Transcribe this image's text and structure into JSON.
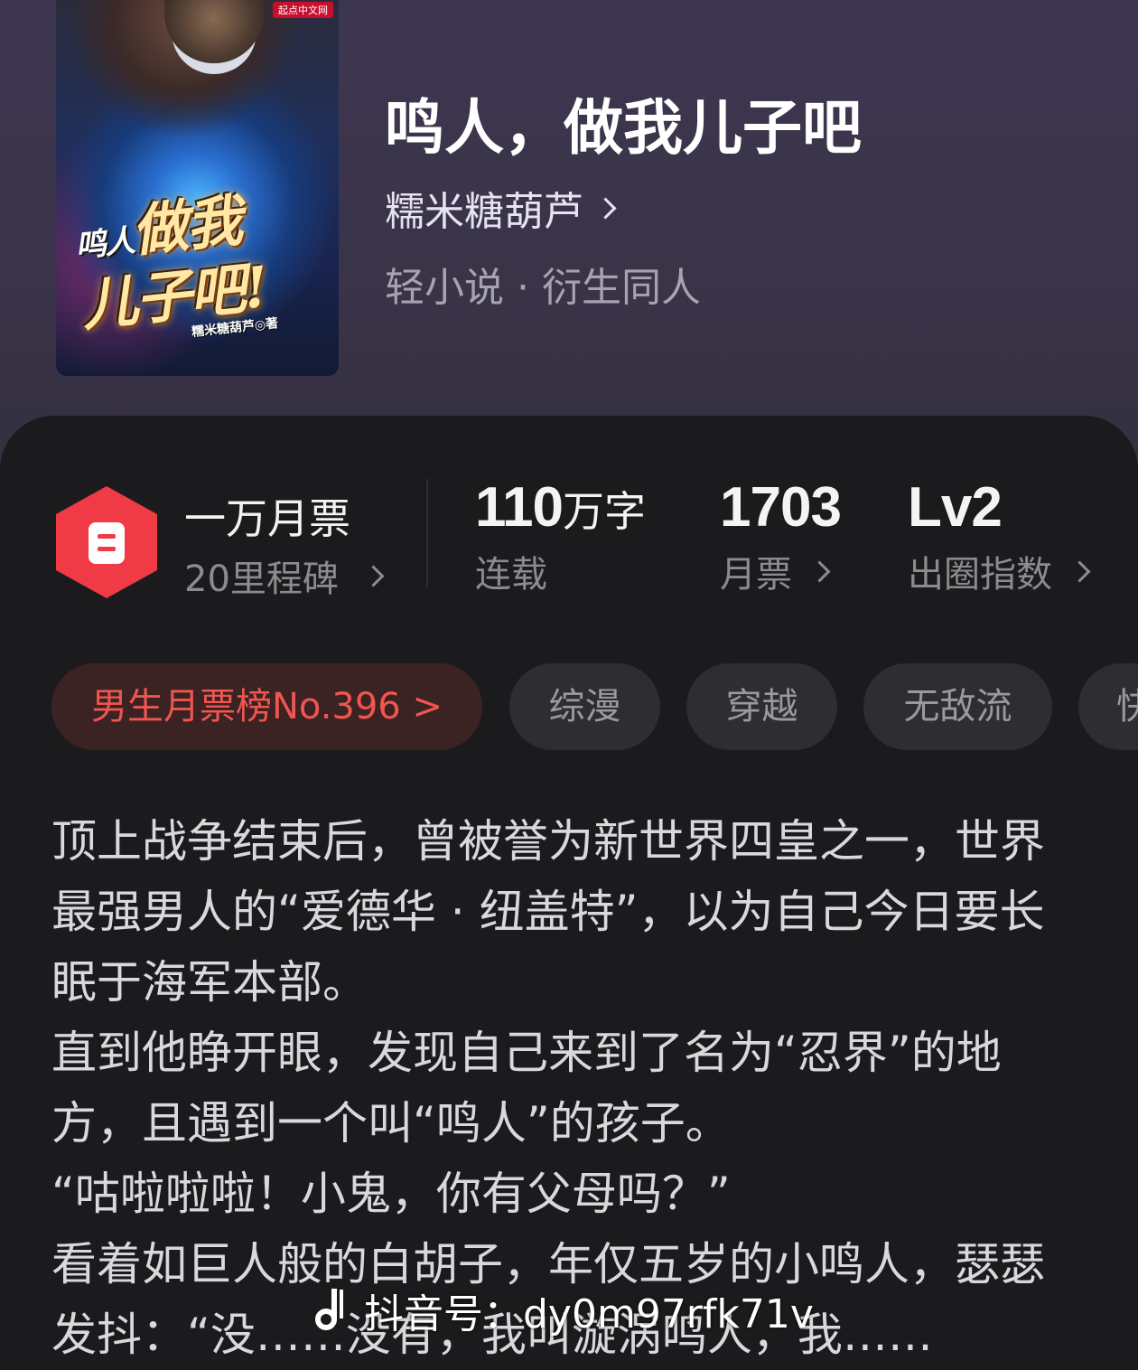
{
  "book": {
    "cover_badge": "起点中文网",
    "cover_title_line1_small": "鸣人",
    "cover_title_line1": "做我",
    "cover_title_line2": "儿子吧!",
    "cover_author": "糯米糖葫芦◎著",
    "title": "鸣人，做我儿子吧",
    "author": "糯米糖葫芦",
    "genre": "轻小说 · 衍生同人"
  },
  "stats": {
    "milestone_main": "一万月票",
    "milestone_sub": "20里程碑",
    "word_count": "110",
    "word_unit": "万字",
    "status": "连载",
    "monthly_votes": "1703",
    "monthly_votes_label": "月票",
    "level": "Lv2",
    "level_label": "出圈指数"
  },
  "tags": [
    {
      "label": "男生月票榜No.396 >"
    },
    {
      "label": "综漫"
    },
    {
      "label": "穿越"
    },
    {
      "label": "无敌流"
    },
    {
      "label": "快"
    }
  ],
  "synopsis": {
    "p1": "顶上战争结束后，曾被誉为新世界四皇之一，世界最强男人的“爱德华 · 纽盖特”，以为自己今日要长眠于海军本部。",
    "p2": "直到他睁开眼，发现自己来到了名为“忍界”的地方，且遇到一个叫“鸣人”的孩子。",
    "p3": "“咕啦啦啦！小鬼，你有父母吗？”",
    "p4": "看着如巨人般的白胡子，年仅五岁的小鸣人，瑟瑟发抖：“没……没有，我叫漩涡鸣人，我……"
  },
  "watermark": {
    "text": "抖音号：dy0m97rfk71v"
  },
  "colors": {
    "header_bg": "#3d3650",
    "card_bg": "#1b1b1d",
    "accent_red": "#f03a45",
    "rank_tag_text": "#f05550",
    "rank_tag_bg": "#3b2323",
    "tag_bg": "#2e2e31"
  },
  "icons": {
    "milestone": "ticket-hexagon-icon",
    "chevron": "chevron-right-icon",
    "watermark": "tiktok-icon"
  }
}
